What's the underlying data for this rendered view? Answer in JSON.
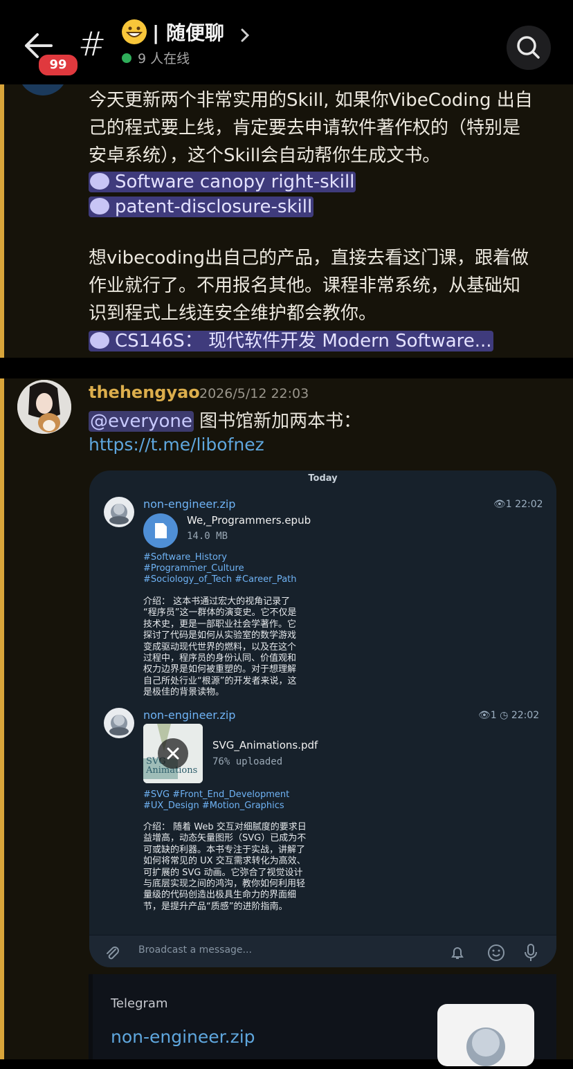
{
  "header": {
    "badge": "99",
    "emoji": "😄",
    "title": "| 随便聊",
    "online": "9 人在线"
  },
  "message1": {
    "line1": "今天更新两个非常实用的Skill, 如果你VibeCoding 出自",
    "line2": "己的程式要上线，肯定要去申请软件著作权的（特别是",
    "line3": "安卓系统），这个Skill会自动帮你生成文书。",
    "link1": "Software canopy right-skill",
    "link2": "patent-disclosure-skill",
    "line4": "想vibecoding出自己的产品，直接去看这门课，跟着做",
    "line5": "作业就行了。不用报名其他。课程非常系统，从基础知",
    "line6": "识到程式上线连安全维护都会教你。",
    "link3": "CS146S：  现代软件开发 Modern Software..."
  },
  "message2": {
    "username": "thehengyao",
    "timestamp": "2026/5/12 22:03",
    "mention": "@everyone",
    "text": " 图书馆新加两本书：",
    "url": "https://t.me/libofnez"
  },
  "telegram": {
    "day": "Today",
    "post1": {
      "sender": "non-engineer.zip",
      "views": "1",
      "time": "22:02",
      "filename": "We,_Programmers.epub",
      "size": "14.0 MB",
      "tag1": "#Software_History",
      "tag2": "#Programmer_Culture",
      "tag3": "#Sociology_of_Tech #Career_Path",
      "intro": [
        "介绍：  这本书通过宏大的视角记录了",
        "“程序员”这一群体的演变史。它不仅是",
        "技术史，更是一部职业社会学著作。它",
        "探讨了代码是如何从实验室的数学游戏",
        "变成驱动现代世界的燃料，以及在这个",
        "过程中，程序员的身份认同、价值观和",
        "权力边界是如何被重塑的。对于想理解",
        "自己所处行业“根源”的开发者来说，这",
        "是极佳的背景读物。"
      ]
    },
    "post2": {
      "sender": "non-engineer.zip",
      "views": "1",
      "time": "22:02",
      "filename": "SVG_Animations.pdf",
      "progress": "76% uploaded",
      "progress_value": 76,
      "cover_text": "SVG Animations",
      "tag1": "#SVG #Front_End_Development",
      "tag2": "#UX_Design #Motion_Graphics",
      "intro": [
        "介绍：  随着 Web 交互对细腻度的要求日",
        "益增高，动态矢量图形（SVG）已成为不",
        "可或缺的利器。本书专注于实战，讲解了",
        "如何将常见的 UX 交互需求转化为高效、",
        "可扩展的 SVG 动画。它弥合了视觉设计",
        "与底层实现之间的鸿沟，教你如何利用轻",
        "量级的代码创造出极具生命力的界面细",
        "节，是提升产品“质感”的进阶指南。"
      ]
    },
    "input_placeholder": "Broadcast a message..."
  },
  "preview": {
    "site": "Telegram",
    "title": "non-engineer.zip"
  }
}
